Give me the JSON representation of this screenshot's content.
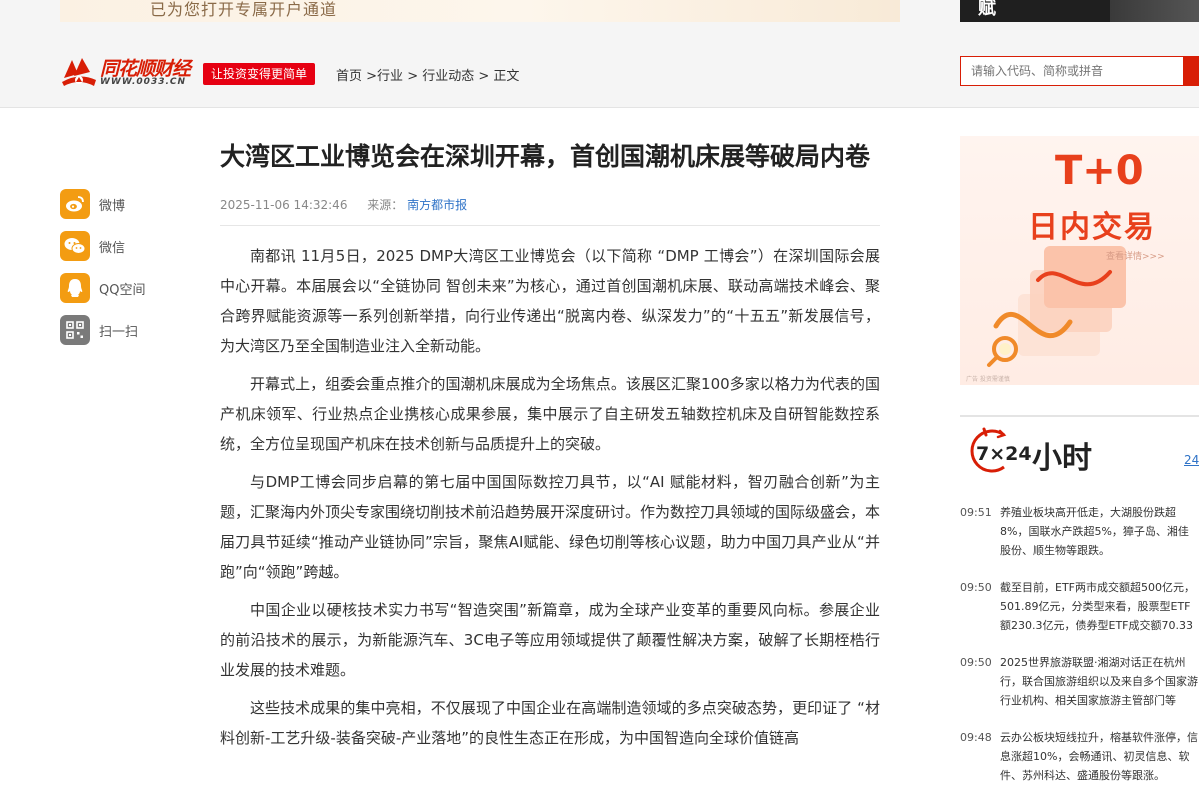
{
  "top_banner": {
    "text": "已为您打开专属开户通道",
    "right_text": "赋"
  },
  "header": {
    "logo_text": "同花顺财经",
    "logo_url": "WWW.0033.CN",
    "slogan": "让投资变得更简单",
    "breadcrumb": [
      {
        "label": "首页"
      },
      {
        "label": "行业"
      },
      {
        "label": "行业动态"
      },
      {
        "label": "正文"
      }
    ],
    "search_placeholder": "请输入代码、简称或拼音"
  },
  "share": [
    {
      "label": "微博",
      "icon": "weibo-icon",
      "color": "#f39c12"
    },
    {
      "label": "微信",
      "icon": "wechat-icon",
      "color": "#f39c12"
    },
    {
      "label": "QQ空间",
      "icon": "qzone-icon",
      "color": "#f39c12"
    },
    {
      "label": "扫一扫",
      "icon": "qrcode-icon",
      "color": "#7a7a7a"
    }
  ],
  "article": {
    "title": "大湾区工业博览会在深圳开幕，首创国潮机床展等破局内卷",
    "time": "2025-11-06 14:32:46",
    "source_label": "来源：",
    "source": "南方都市报",
    "paragraphs": [
      "南都讯 11月5日，2025 DMP大湾区工业博览会（以下简称 “DMP 工博会”）在深圳国际会展中心开幕。本届展会以“全链协同 智创未来”为核心，通过首创国潮机床展、联动高端技术峰会、聚合跨界赋能资源等一系列创新举措，向行业传递出“脱离内卷、纵深发力”的“十五五”新发展信号，为大湾区乃至全国制造业注入全新动能。",
      "开幕式上，组委会重点推介的国潮机床展成为全场焦点。该展区汇聚100多家以格力为代表的国产机床领军、行业热点企业携核心成果参展，集中展示了自主研发五轴数控机床及自研智能数控系统，全方位呈现国产机床在技术创新与品质提升上的突破。",
      "与DMP工博会同步启幕的第七届中国国际数控刀具节，以“AI 赋能材料，智刃融合创新”为主题，汇聚海内外顶尖专家围绕切削技术前沿趋势展开深度研讨。作为数控刀具领域的国际级盛会，本届刀具节延续“推动产业链协同”宗旨，聚焦AI赋能、绿色切削等核心议题，助力中国刀具产业从“并跑”向“领跑”跨越。",
      "中国企业以硬核技术实力书写“智造突围”新篇章，成为全球产业变革的重要风向标。参展企业的前沿技术的展示，为新能源汽车、3C电子等应用领域提供了颠覆性解决方案，破解了长期桎梏行业发展的技术难题。",
      "这些技术成果的集中亮相，不仅展现了中国企业在高端制造领域的多点突破态势，更印证了 “材料创新-工艺升级-装备突破-产业落地”的良性生态正在形成，为中国智造向全球价值链高"
    ]
  },
  "side_ad": {
    "headline": "T+0",
    "subline": "日内交易",
    "more": "查看详情>>>",
    "tiny": "广告 投资需谨慎"
  },
  "news724": {
    "badge": "7×24",
    "title": "小时",
    "more": "24",
    "items": [
      {
        "time": "09:51",
        "text": "养殖业板块高开低走，大湖股份跌超8%，国联水产跌超5%，獐子岛、湘佳股份、顺生物等跟跌。"
      },
      {
        "time": "09:50",
        "text": "截至目前，ETF两市成交额超500亿元，501.89亿元，分类型来看，股票型ETF额230.3亿元，债券型ETF成交额70.33"
      },
      {
        "time": "09:50",
        "text": "2025世界旅游联盟·湘湖对话正在杭州行，联合国旅游组织以及来自多个国家游行业机构、相关国家旅游主管部门等"
      },
      {
        "time": "09:48",
        "text": "云办公板块短线拉升，榕基软件涨停，信息涨超10%，会畅通讯、初灵信息、软件、苏州科达、盛通股份等跟涨。"
      }
    ]
  }
}
